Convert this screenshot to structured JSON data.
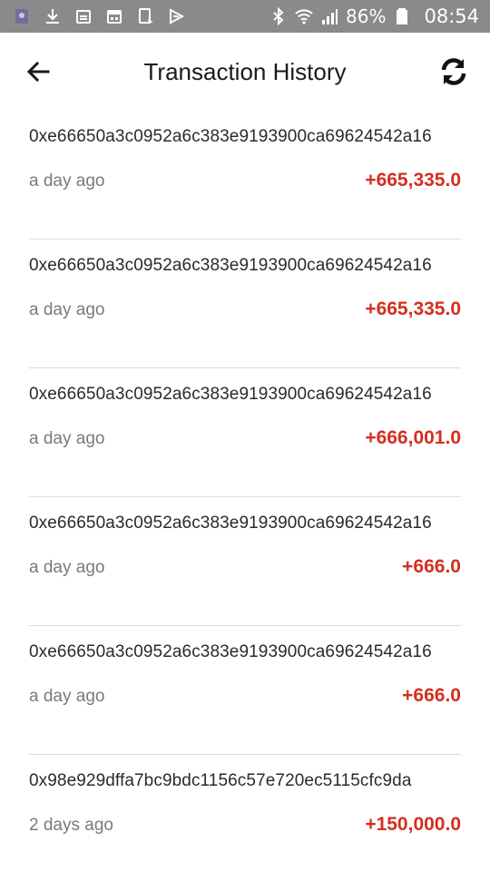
{
  "status_bar": {
    "icons_left": [
      "app-icon",
      "download-icon",
      "calendar-icon",
      "calendar-icon",
      "screen-icon",
      "play-icon"
    ],
    "battery_percent": "86%",
    "time": "08:54",
    "icons_right": [
      "bluetooth-icon",
      "wifi-icon",
      "signal-icon",
      "battery-icon"
    ]
  },
  "header": {
    "title": "Transaction History",
    "back_icon": "arrow-left-icon",
    "refresh_icon": "refresh-icon"
  },
  "colors": {
    "status_bar_bg": "#8a8a8a",
    "amount_positive": "#d32f1f",
    "divider": "#dcdcdc"
  },
  "transactions": [
    {
      "hash": "0xe66650a3c0952a6c383e9193900ca69624542a16",
      "time": "a day ago",
      "amount": "+665,335.0"
    },
    {
      "hash": "0xe66650a3c0952a6c383e9193900ca69624542a16",
      "time": "a day ago",
      "amount": "+665,335.0"
    },
    {
      "hash": "0xe66650a3c0952a6c383e9193900ca69624542a16",
      "time": "a day ago",
      "amount": "+666,001.0"
    },
    {
      "hash": "0xe66650a3c0952a6c383e9193900ca69624542a16",
      "time": "a day ago",
      "amount": "+666.0"
    },
    {
      "hash": "0xe66650a3c0952a6c383e9193900ca69624542a16",
      "time": "a day ago",
      "amount": "+666.0"
    },
    {
      "hash": "0x98e929dffa7bc9bdc1156c57e720ec5115cfc9da",
      "time": "2 days ago",
      "amount": "+150,000.0"
    }
  ]
}
